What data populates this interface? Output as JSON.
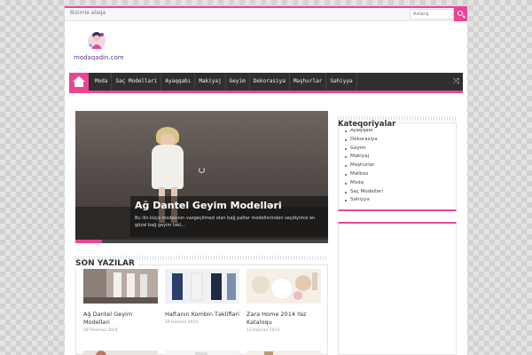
{
  "topbar": {
    "contact_link": "Bizimle əlaqə",
    "search_placeholder": "Axtarış"
  },
  "logo": {
    "text": "modaqadin.com"
  },
  "nav": {
    "items": [
      "Moda",
      "Saç Modelləri",
      "Ayaqqabı",
      "Makiyaj",
      "Geyim",
      "Dekorasiya",
      "Məşhurlar",
      "Səhiyyə"
    ],
    "shuffle_icon": "⤨"
  },
  "slider": {
    "title": "Ağ Dantel Geyim Modelləri",
    "description": "Bu ilin küçə modasının vazgeçilmezi olan bağ paltar modellərindən seçdiyimiz ən gözəl bağ geyim təkl..."
  },
  "recent": {
    "heading": "SON YAZILAR",
    "posts": [
      {
        "title": "Ağ Dantel Geyim Modelləri",
        "date": "08 Temmuz 2014"
      },
      {
        "title": "Haftanın Kombin Təklifləri",
        "date": "19 Haziran 2014"
      },
      {
        "title": "Zara Home 2014 Yaz Kataloqu",
        "date": "13 Haziran 2014"
      }
    ]
  },
  "sidebar": {
    "heading": "Kateqoriyalar",
    "categories": [
      "Ayaqqabı",
      "Dekorasiya",
      "Geyim",
      "Makiyaj",
      "Məşhurlar",
      "Mətbəx",
      "Moda",
      "Saç Modelləri",
      "Səhiyyə"
    ]
  },
  "colors": {
    "accent": "#e94595",
    "nav_bg": "#2f2f2f"
  }
}
